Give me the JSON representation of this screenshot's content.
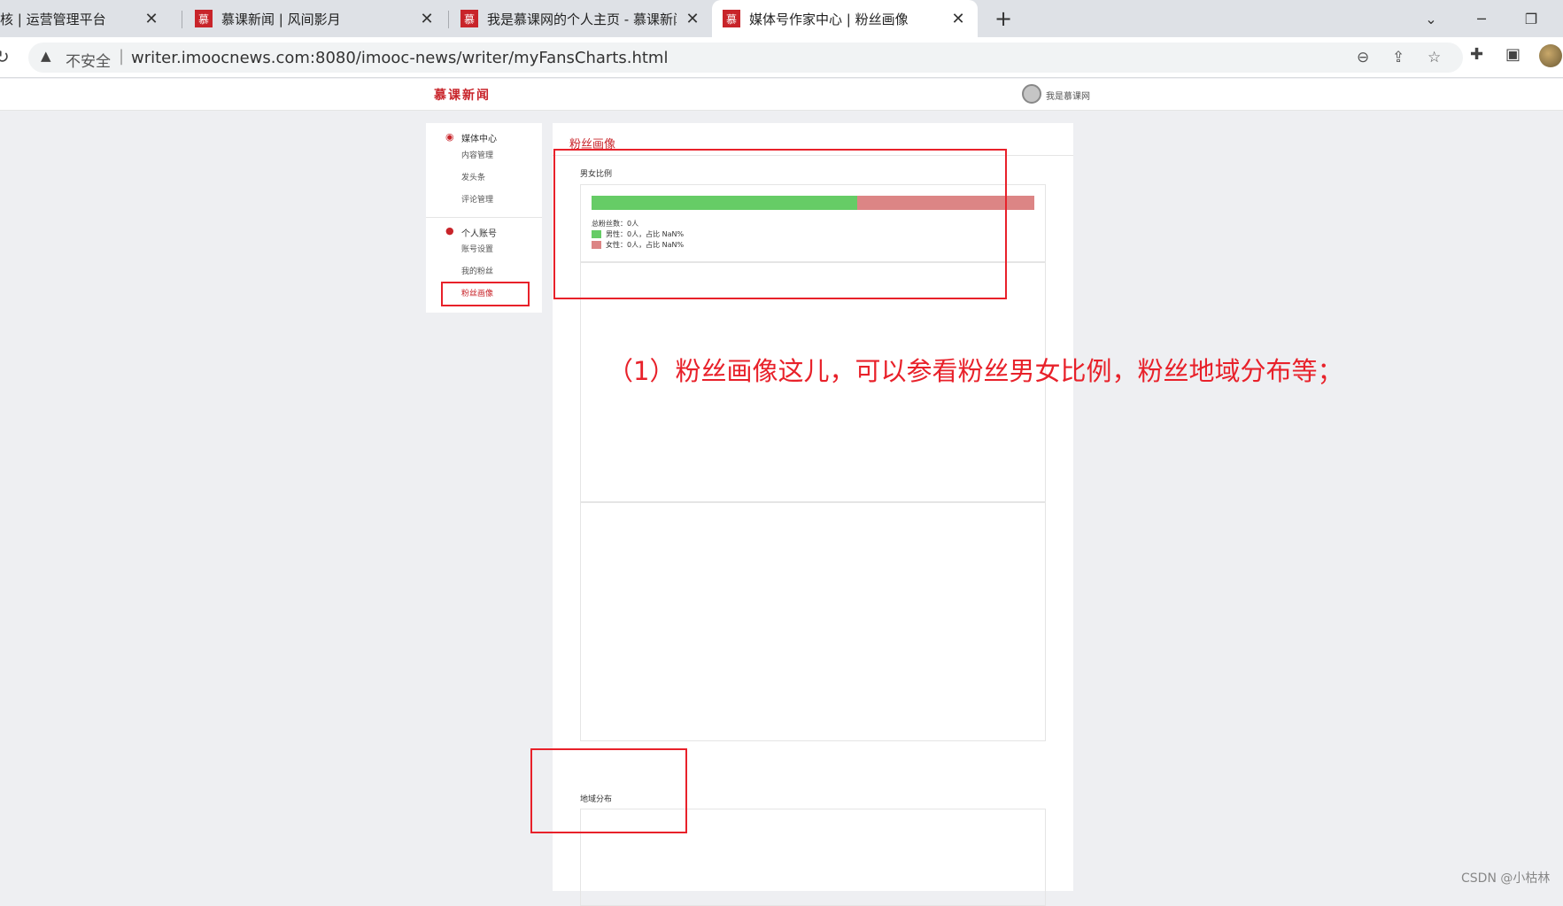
{
  "tabs": [
    {
      "title": "核 | 运营管理平台",
      "favicon": "",
      "active": false
    },
    {
      "title": "慕课新闻 | 风间影月",
      "favicon": "慕",
      "active": false
    },
    {
      "title": "我是慕课网的个人主页 - 慕课新闻",
      "favicon": "慕",
      "active": false
    },
    {
      "title": "媒体号作家中心 | 粉丝画像",
      "favicon": "慕",
      "active": true
    }
  ],
  "address_bar": {
    "security_label": "不安全",
    "url": "writer.imoocnews.com:8080/imooc-news/writer/myFansCharts.html"
  },
  "site": {
    "logo": "慕课新闻",
    "user_name": "我是慕课网"
  },
  "sidebar": {
    "groups": [
      {
        "title": "媒体中心",
        "icon": "rss-icon",
        "items": [
          "内容管理",
          "发头条",
          "评论管理"
        ]
      },
      {
        "title": "个人账号",
        "icon": "user-icon",
        "items": [
          "账号设置",
          "我的粉丝",
          "粉丝画像"
        ]
      }
    ]
  },
  "main": {
    "title": "粉丝画像",
    "gender_section": {
      "title": "男女比例",
      "male_fraction": 0.6,
      "total_label": "总粉丝数：0人",
      "male_label": "男性：0人，占比 NaN%",
      "female_label": "女性：0人，占比 NaN%",
      "male_color": "#66cc66",
      "female_color": "#dc8585"
    },
    "region_section": {
      "title": "地域分布"
    }
  },
  "annotation": {
    "text": "（1）粉丝画像这儿，可以参看粉丝男女比例，粉丝地域分布等；",
    "color": "#e8212a"
  },
  "watermark": "CSDN @小枯林"
}
